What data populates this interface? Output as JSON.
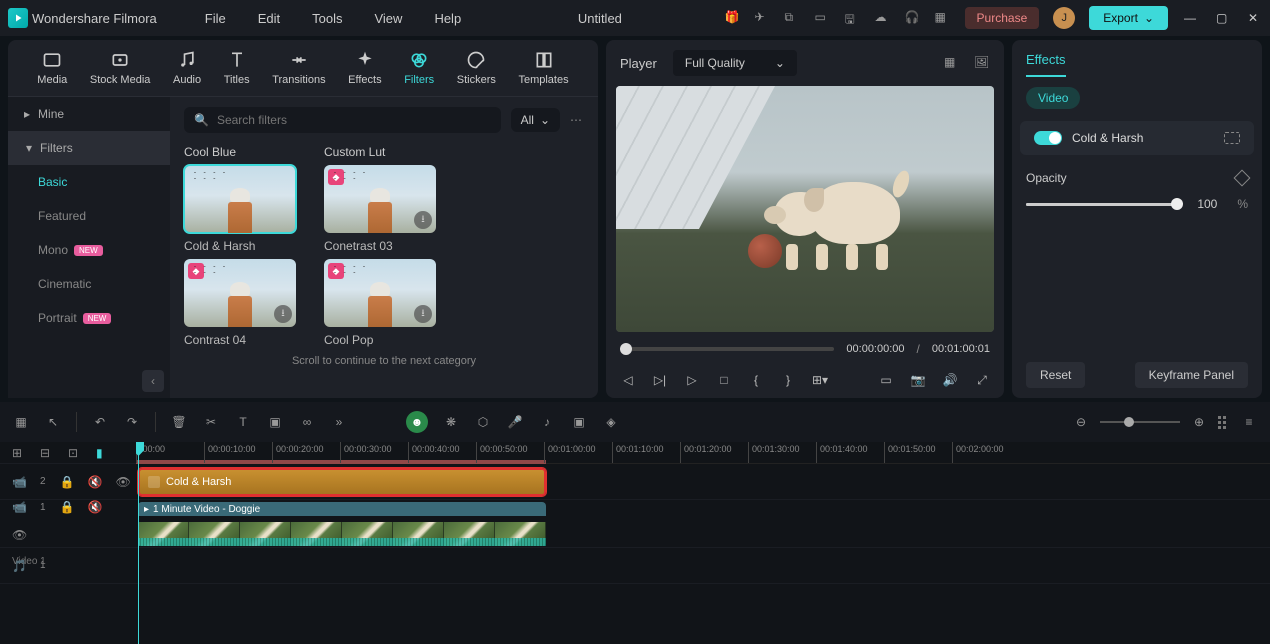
{
  "app": {
    "name": "Wondershare Filmora",
    "title": "Untitled"
  },
  "menus": [
    "File",
    "Edit",
    "Tools",
    "View",
    "Help"
  ],
  "header": {
    "purchase": "Purchase",
    "export": "Export",
    "avatar_initial": "J"
  },
  "mediaTabs": [
    "Media",
    "Stock Media",
    "Audio",
    "Titles",
    "Transitions",
    "Effects",
    "Filters",
    "Stickers",
    "Templates"
  ],
  "sidebar": {
    "mine": "Mine",
    "filters": "Filters",
    "subs": [
      {
        "label": "Basic"
      },
      {
        "label": "Featured"
      },
      {
        "label": "Mono",
        "badge": "NEW"
      },
      {
        "label": "Cinematic"
      },
      {
        "label": "Portrait",
        "badge": "NEW"
      }
    ]
  },
  "search": {
    "placeholder": "Search filters",
    "all": "All"
  },
  "filterCategories": {
    "col1": "Cool Blue",
    "col2": "Custom Lut",
    "items": [
      {
        "name": "Cold & Harsh"
      },
      {
        "name": "Conetrast 03"
      },
      {
        "name": "Contrast 04"
      },
      {
        "name": "Cool Pop"
      }
    ],
    "scrollHint": "Scroll to continue to the next category"
  },
  "player": {
    "label": "Player",
    "quality": "Full Quality",
    "current": "00:00:00:00",
    "duration": "00:01:00:01"
  },
  "effects": {
    "tab": "Effects",
    "videoChip": "Video",
    "toggleLabel": "Cold & Harsh",
    "opacity": {
      "label": "Opacity",
      "value": "100",
      "unit": "%"
    },
    "reset": "Reset",
    "keyframe": "Keyframe Panel"
  },
  "ruler": [
    ":00:00",
    "00:00:10:00",
    "00:00:20:00",
    "00:00:30:00",
    "00:00:40:00",
    "00:00:50:00",
    "00:01:00:00",
    "00:01:10:00",
    "00:01:20:00",
    "00:01:30:00",
    "00:01:40:00",
    "00:01:50:00",
    "00:02:00:00"
  ],
  "tracks": {
    "filterClip": "Cold & Harsh",
    "videoClip": "1 Minute Video - Doggie",
    "videoLabel": "Video 1",
    "t2": "2",
    "t1": "1"
  }
}
